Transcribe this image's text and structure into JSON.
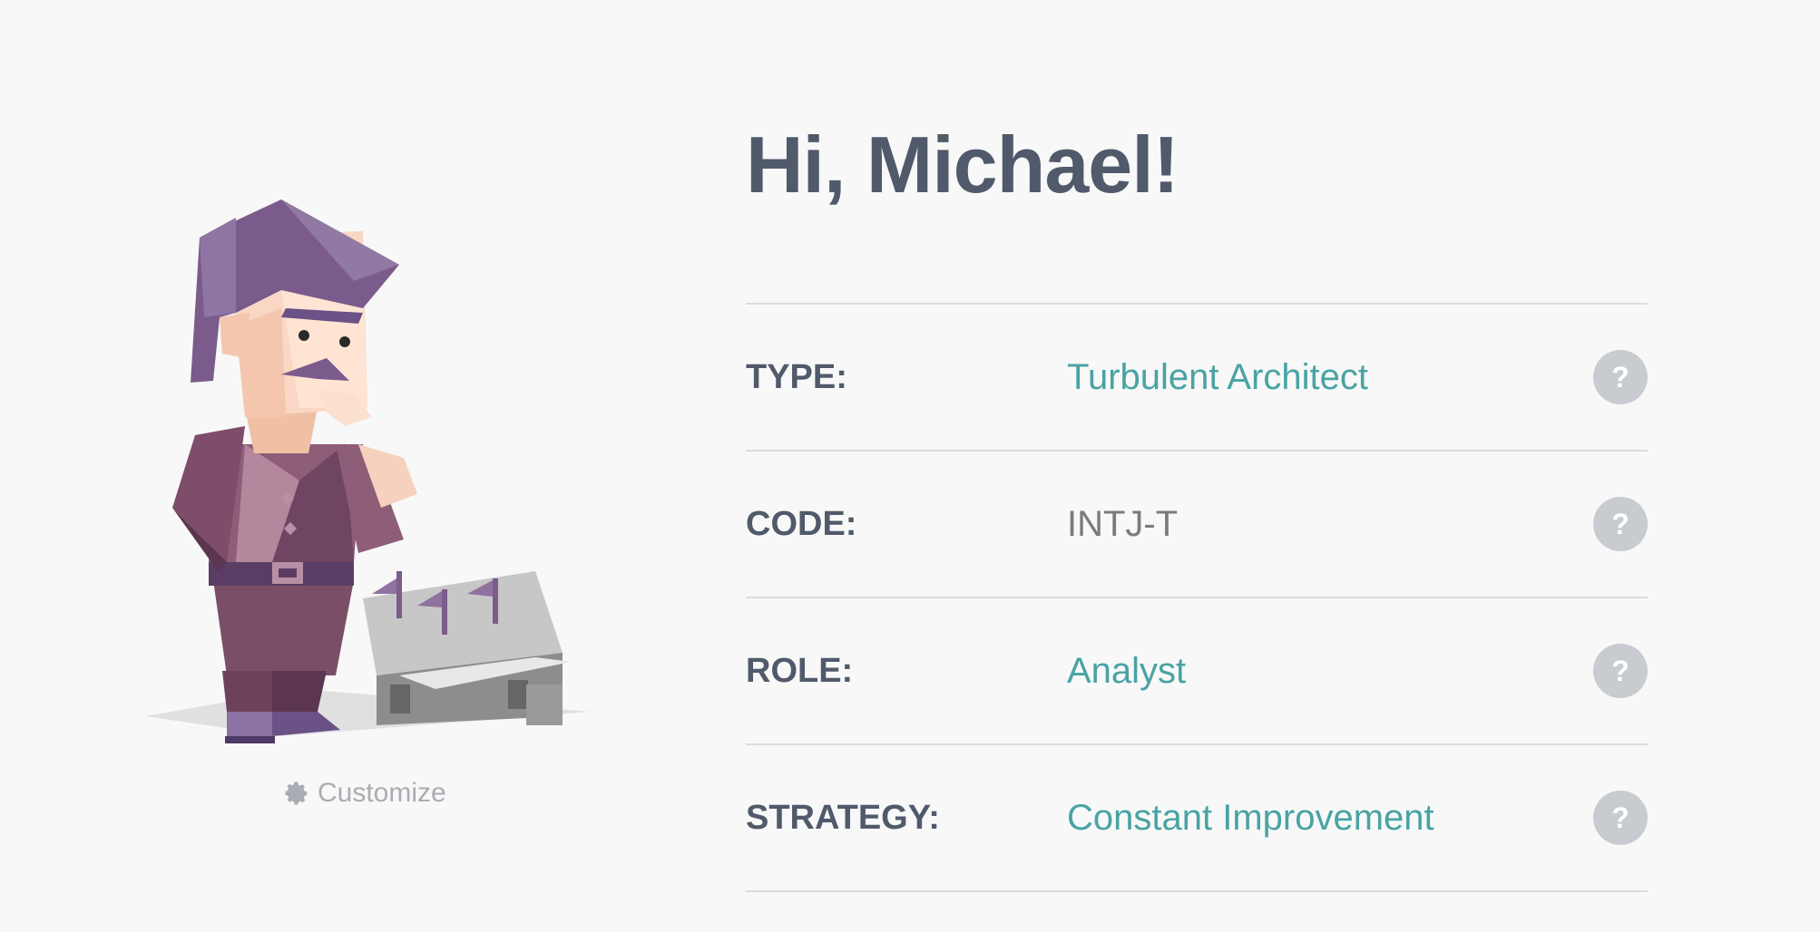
{
  "avatar": {
    "customize_label": "Customize",
    "customize_icon": "gear-icon"
  },
  "greeting": "Hi, Michael!",
  "rows": [
    {
      "label": "TYPE:",
      "value": "Turbulent Architect",
      "help": "?"
    },
    {
      "label": "CODE:",
      "value": "INTJ-T",
      "help": "?"
    },
    {
      "label": "ROLE:",
      "value": "Analyst",
      "help": "?"
    },
    {
      "label": "STRATEGY:",
      "value": "Constant Improvement",
      "help": "?"
    }
  ],
  "colors": {
    "heading": "#505a6b",
    "accent": "#4aa3a3",
    "muted": "#7b7b7b",
    "help_button": "#c8cbd0",
    "background": "#f8f8f8"
  }
}
